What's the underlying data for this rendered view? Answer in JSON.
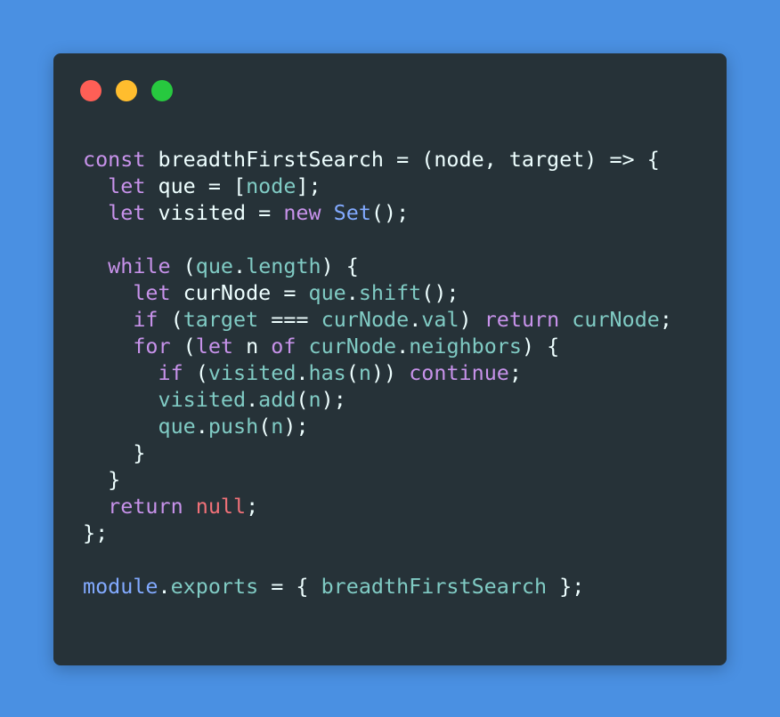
{
  "colors": {
    "background": "#4a90e2",
    "window": "#263238",
    "dot_red": "#ff5f56",
    "dot_yellow": "#ffbd2e",
    "dot_green": "#27c93f",
    "keyword": "#c792ea",
    "plain": "#eeffff",
    "property": "#80cbc4",
    "builtin": "#82aaff",
    "null": "#f07178"
  },
  "code": {
    "lines": [
      [
        {
          "t": "const",
          "c": "keyword"
        },
        {
          "t": " breadthFirstSearch = (node, target) => {",
          "c": "plain"
        }
      ],
      [
        {
          "t": "  ",
          "c": "plain"
        },
        {
          "t": "let",
          "c": "keyword"
        },
        {
          "t": " que = [",
          "c": "plain"
        },
        {
          "t": "node",
          "c": "property"
        },
        {
          "t": "];",
          "c": "plain"
        }
      ],
      [
        {
          "t": "  ",
          "c": "plain"
        },
        {
          "t": "let",
          "c": "keyword"
        },
        {
          "t": " visited = ",
          "c": "plain"
        },
        {
          "t": "new",
          "c": "keyword"
        },
        {
          "t": " ",
          "c": "plain"
        },
        {
          "t": "Set",
          "c": "builtin"
        },
        {
          "t": "();",
          "c": "plain"
        }
      ],
      [],
      [
        {
          "t": "  ",
          "c": "plain"
        },
        {
          "t": "while",
          "c": "keyword"
        },
        {
          "t": " (",
          "c": "plain"
        },
        {
          "t": "que",
          "c": "property"
        },
        {
          "t": ".",
          "c": "plain"
        },
        {
          "t": "length",
          "c": "property"
        },
        {
          "t": ") {",
          "c": "plain"
        }
      ],
      [
        {
          "t": "    ",
          "c": "plain"
        },
        {
          "t": "let",
          "c": "keyword"
        },
        {
          "t": " curNode = ",
          "c": "plain"
        },
        {
          "t": "que",
          "c": "property"
        },
        {
          "t": ".",
          "c": "plain"
        },
        {
          "t": "shift",
          "c": "property"
        },
        {
          "t": "();",
          "c": "plain"
        }
      ],
      [
        {
          "t": "    ",
          "c": "plain"
        },
        {
          "t": "if",
          "c": "keyword"
        },
        {
          "t": " (",
          "c": "plain"
        },
        {
          "t": "target",
          "c": "property"
        },
        {
          "t": " === ",
          "c": "plain"
        },
        {
          "t": "curNode",
          "c": "property"
        },
        {
          "t": ".",
          "c": "plain"
        },
        {
          "t": "val",
          "c": "property"
        },
        {
          "t": ") ",
          "c": "plain"
        },
        {
          "t": "return",
          "c": "keyword"
        },
        {
          "t": " ",
          "c": "plain"
        },
        {
          "t": "curNode",
          "c": "property"
        },
        {
          "t": ";",
          "c": "plain"
        }
      ],
      [
        {
          "t": "    ",
          "c": "plain"
        },
        {
          "t": "for",
          "c": "keyword"
        },
        {
          "t": " (",
          "c": "plain"
        },
        {
          "t": "let",
          "c": "keyword"
        },
        {
          "t": " n ",
          "c": "plain"
        },
        {
          "t": "of",
          "c": "keyword"
        },
        {
          "t": " ",
          "c": "plain"
        },
        {
          "t": "curNode",
          "c": "property"
        },
        {
          "t": ".",
          "c": "plain"
        },
        {
          "t": "neighbors",
          "c": "property"
        },
        {
          "t": ") {",
          "c": "plain"
        }
      ],
      [
        {
          "t": "      ",
          "c": "plain"
        },
        {
          "t": "if",
          "c": "keyword"
        },
        {
          "t": " (",
          "c": "plain"
        },
        {
          "t": "visited",
          "c": "property"
        },
        {
          "t": ".",
          "c": "plain"
        },
        {
          "t": "has",
          "c": "property"
        },
        {
          "t": "(",
          "c": "plain"
        },
        {
          "t": "n",
          "c": "property"
        },
        {
          "t": ")) ",
          "c": "plain"
        },
        {
          "t": "continue",
          "c": "keyword"
        },
        {
          "t": ";",
          "c": "plain"
        }
      ],
      [
        {
          "t": "      ",
          "c": "plain"
        },
        {
          "t": "visited",
          "c": "property"
        },
        {
          "t": ".",
          "c": "plain"
        },
        {
          "t": "add",
          "c": "property"
        },
        {
          "t": "(",
          "c": "plain"
        },
        {
          "t": "n",
          "c": "property"
        },
        {
          "t": ");",
          "c": "plain"
        }
      ],
      [
        {
          "t": "      ",
          "c": "plain"
        },
        {
          "t": "que",
          "c": "property"
        },
        {
          "t": ".",
          "c": "plain"
        },
        {
          "t": "push",
          "c": "property"
        },
        {
          "t": "(",
          "c": "plain"
        },
        {
          "t": "n",
          "c": "property"
        },
        {
          "t": ");",
          "c": "plain"
        }
      ],
      [
        {
          "t": "    }",
          "c": "plain"
        }
      ],
      [
        {
          "t": "  }",
          "c": "plain"
        }
      ],
      [
        {
          "t": "  ",
          "c": "plain"
        },
        {
          "t": "return",
          "c": "keyword"
        },
        {
          "t": " ",
          "c": "plain"
        },
        {
          "t": "null",
          "c": "null"
        },
        {
          "t": ";",
          "c": "plain"
        }
      ],
      [
        {
          "t": "};",
          "c": "plain"
        }
      ],
      [],
      [
        {
          "t": "module",
          "c": "builtin"
        },
        {
          "t": ".",
          "c": "plain"
        },
        {
          "t": "exports",
          "c": "property"
        },
        {
          "t": " = { ",
          "c": "plain"
        },
        {
          "t": "breadthFirstSearch",
          "c": "property"
        },
        {
          "t": " };",
          "c": "plain"
        }
      ]
    ]
  }
}
